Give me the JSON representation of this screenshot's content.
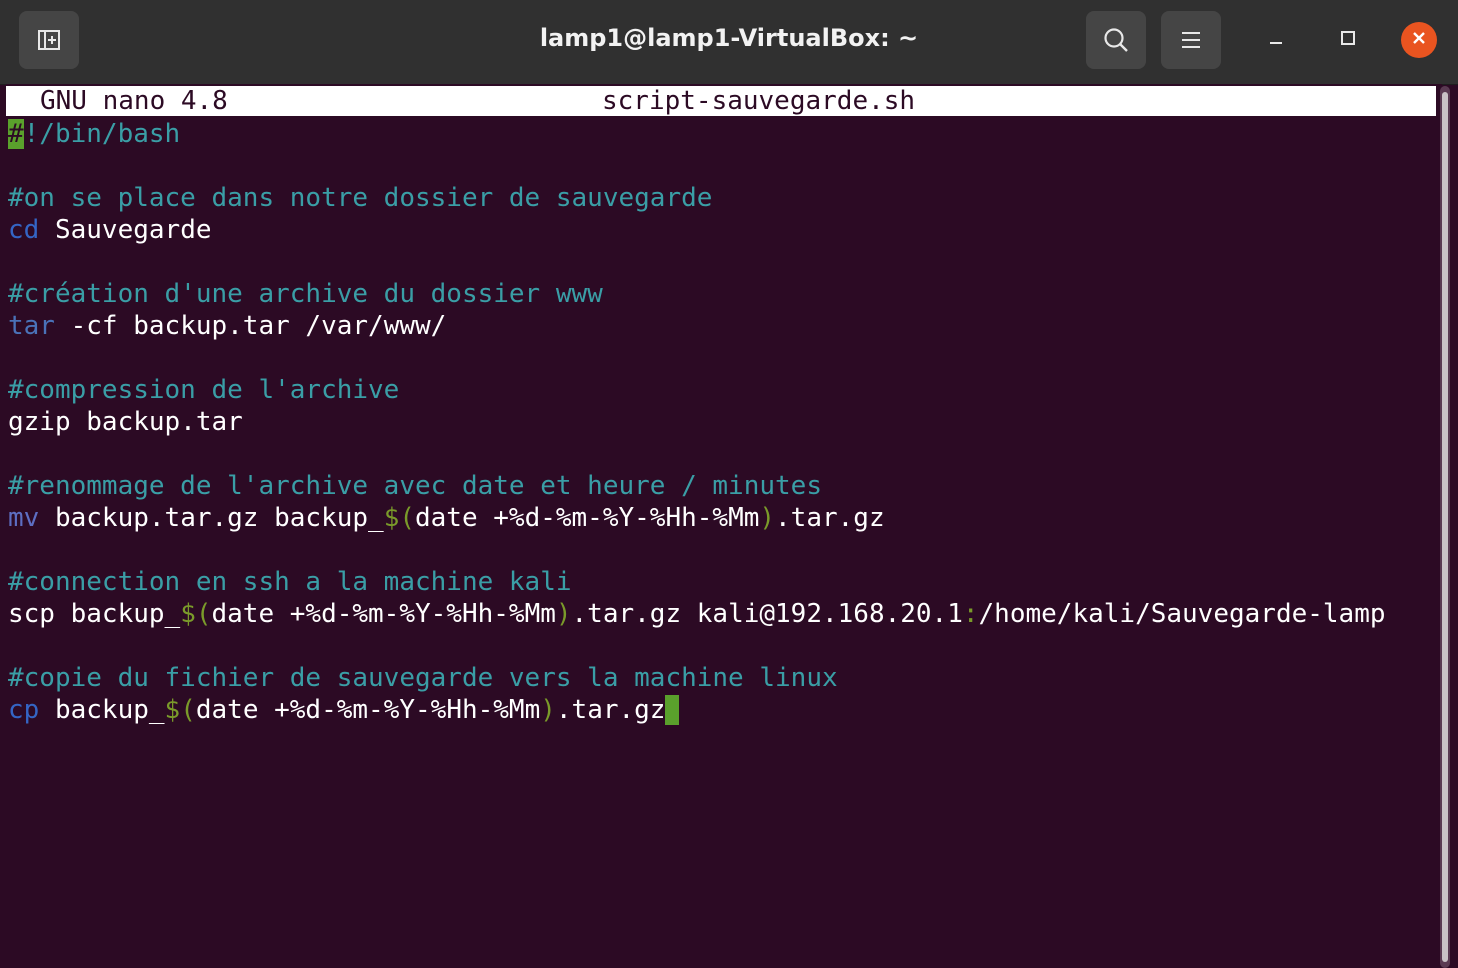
{
  "window": {
    "title": "lamp1@lamp1-VirtualBox: ~"
  },
  "titlebar": {
    "icons": [
      "new-tab-icon",
      "search-icon",
      "hamburger-menu-icon",
      "minimize-icon",
      "maximize-icon",
      "close-icon"
    ],
    "accent_close": "#e95420"
  },
  "nano": {
    "version": "GNU nano 4.8",
    "filename": "script-sauvegarde.sh"
  },
  "script": {
    "shebang_first": "#",
    "shebang_rest": "!/bin/bash",
    "comment1": "#on se place dans notre dossier de sauvegarde",
    "cd_cmd": "cd",
    "cd_arg": " Sauvegarde",
    "comment2": "#création d'une archive du dossier www",
    "tar_cmd": "tar",
    "tar_args": " -cf backup.tar /var/www/",
    "comment3": "#compression de l'archive",
    "gzip_line": "gzip backup.tar",
    "comment4": "#renommage de l'archive avec date et heure / minutes",
    "mv_cmd": "mv",
    "mv_part1": " backup.tar.gz backup_",
    "mv_subst_open": "$(",
    "mv_inner": "date +%d-%m-%Y-%Hh-%Mm",
    "mv_subst_close": ")",
    "mv_tail": ".tar.gz",
    "comment5": "#connection en ssh a la machine kali",
    "scp_part1": "scp backup_",
    "scp_subst_open": "$(",
    "scp_inner": "date +%d-%m-%Y-%Hh-%Mm",
    "scp_subst_close": ")",
    "scp_part2": ".tar.gz kali@192.168.20.1",
    "scp_colon": ":",
    "scp_part3": "/home/kali/Sauvegarde-lamp",
    "comment6": "#copie du fichier de sauvegarde vers la machine linux",
    "cp_cmd": "cp",
    "cp_part1": " backup_",
    "cp_subst_open": "$(",
    "cp_inner": "date +%d-%m-%Y-%Hh-%Mm",
    "cp_subst_close": ")",
    "cp_tail": ".tar.gz"
  },
  "colors": {
    "terminal_bg": "#2c0a24",
    "comment": "#3a9ea6",
    "builtin": "#3465c4",
    "cursor": "#5aa02c"
  }
}
